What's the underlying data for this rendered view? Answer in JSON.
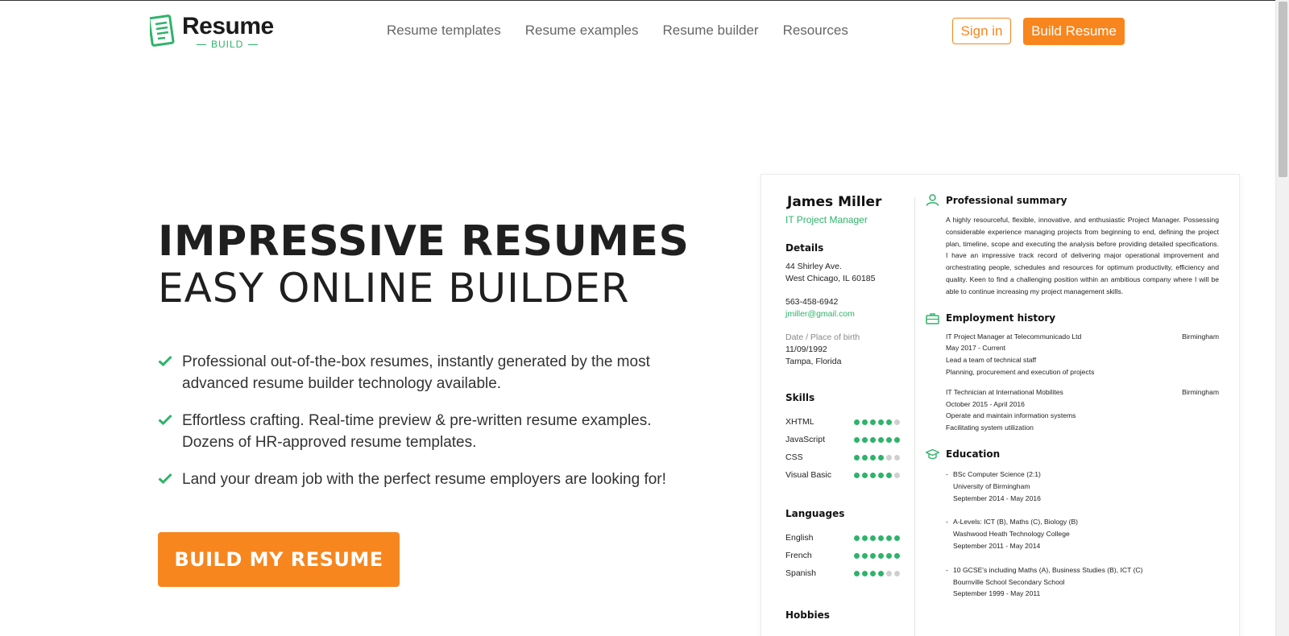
{
  "header": {
    "logo_word": "Resume",
    "logo_sub": "BUILD",
    "nav": [
      "Resume templates",
      "Resume examples",
      "Resume builder",
      "Resources"
    ],
    "signin": "Sign in",
    "build": "Build Resume"
  },
  "hero": {
    "title_line1": "IMPRESSIVE RESUMES",
    "title_line2": "EASY ONLINE BUILDER",
    "bullets": [
      "Professional out-of-the-box resumes, instantly generated by the most advanced resume builder technology available.",
      "Effortless crafting. Real-time preview & pre-written resume examples. Dozens of HR-approved resume templates.",
      "Land your dream job with the perfect resume employers are looking for!"
    ],
    "cta": "BUILD MY RESUME"
  },
  "resume": {
    "name": "James Miller",
    "role": "IT Project Manager",
    "details_heading": "Details",
    "address1": "44 Shirley Ave.",
    "address2": "West Chicago, IL 60185",
    "phone": "563-458-6942",
    "email": "jmiller@gmail.com",
    "dob_label": "Date / Place of birth",
    "dob": "11/09/1992",
    "pob": "Tampa, Florida",
    "skills_heading": "Skills",
    "skills": [
      {
        "name": "XHTML",
        "level": 5
      },
      {
        "name": "JavaScript",
        "level": 6
      },
      {
        "name": "CSS",
        "level": 4
      },
      {
        "name": "Visual Basic",
        "level": 5
      }
    ],
    "languages_heading": "Languages",
    "languages": [
      {
        "name": "English",
        "level": 6
      },
      {
        "name": "French",
        "level": 6
      },
      {
        "name": "Spanish",
        "level": 4
      }
    ],
    "hobbies_heading": "Hobbies",
    "summary_heading": "Professional summary",
    "summary": "A highly resourceful, flexible, innovative, and enthusiastic Project Manager. Possessing considerable experience managing projects from beginning to end, defining the project plan, timeline, scope and executing the analysis before providing detailed specifications. I have an impressive track record of delivering major operational improvement and orchestrating people, schedules and resources for optimum productivity, efficiency and quality. Keen to find a challenging position within an ambitious company where I will be able to continue increasing my project management skills.",
    "employment_heading": "Employment history",
    "jobs": [
      {
        "title": "IT Project Manager at Telecommunicado Ltd",
        "city": "Birmingham",
        "dates": "May 2017 - Current",
        "lines": [
          "Lead a team of technical staff",
          "Planning, procurement and execution of projects"
        ]
      },
      {
        "title": "IT Technician at International Mobilites",
        "city": "Birmingham",
        "dates": "October 2015 - April 2016",
        "lines": [
          "Operate and maintain information systems",
          "Facilitating system utilization"
        ]
      }
    ],
    "education_heading": "Education",
    "education": [
      {
        "degree": "BSc Computer Science (2:1)",
        "school": "University of Birmingham",
        "dates": "September 2014 - May 2016"
      },
      {
        "degree": "A-Levels: ICT (B), Maths (C), Biology (B)",
        "school": "Washwood Heath Technology College",
        "dates": "September 2011 - May 2014"
      },
      {
        "degree": "10 GCSE's including Maths (A), Business Studies (B), ICT (C)",
        "school": "Bournville School Secondary School",
        "dates": "September 1999 - May 2011"
      }
    ],
    "dash": "-"
  },
  "colors": {
    "accent_orange": "#f7861e",
    "accent_green": "#2fb36a"
  },
  "icons": [
    "resume-logo-icon",
    "check-icon",
    "person-icon",
    "briefcase-icon",
    "graduation-cap-icon"
  ]
}
